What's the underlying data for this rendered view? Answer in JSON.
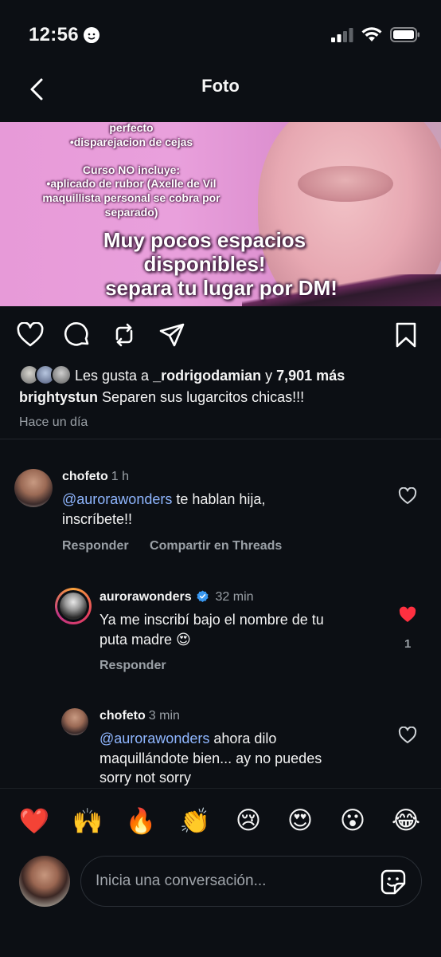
{
  "status_bar": {
    "time": "12:56"
  },
  "nav": {
    "title": "Foto"
  },
  "photo": {
    "line1": "perfecto",
    "line2": "•disparejacion de cejas",
    "line3": "Curso NO incluye:",
    "line4": "•aplicado de rubor (Axelle de Vil",
    "line5": "maquillista personal se cobra por",
    "line6": "separado)",
    "big1": "Muy pocos espacios",
    "big2": "disponibles!",
    "big3": "separa tu lugar por DM!"
  },
  "likes": {
    "prefix": "Les gusta a ",
    "user": "_rodrigodamian",
    "conj": " y ",
    "count": "7,901 más"
  },
  "caption": {
    "user": "brightystun",
    "text": " Separen sus lugarcitos chicas!!!"
  },
  "time_ago": "Hace un día",
  "comments": [
    {
      "user": "chofeto",
      "time": "1 h",
      "mention": "@aurorawonders",
      "text": " te hablan hija,",
      "text2": "inscríbete!!",
      "reply_label": "Responder",
      "share_label": "Compartir en Threads"
    },
    {
      "user": "aurorawonders",
      "time": "32 min",
      "text": "Ya me inscribí bajo el nombre de tu",
      "text2": "puta madre 😍",
      "reply_label": "Responder",
      "likes": "1"
    },
    {
      "user": "chofeto",
      "time": "3 min",
      "mention": "@aurorawonders",
      "text": " ahora dilo",
      "text2": "maquillándote bien... ay no puedes",
      "text3": "sorry not sorry"
    }
  ],
  "reactions": [
    "❤️",
    "🙌",
    "🔥",
    "👏",
    "😢",
    "😍",
    "😮",
    "😂"
  ],
  "input": {
    "placeholder": "Inicia una conversación..."
  },
  "colors": {
    "background": "#0c0f14",
    "mention": "#8fb6ff",
    "like_red": "#ff3040",
    "verified": "#3897f0"
  }
}
